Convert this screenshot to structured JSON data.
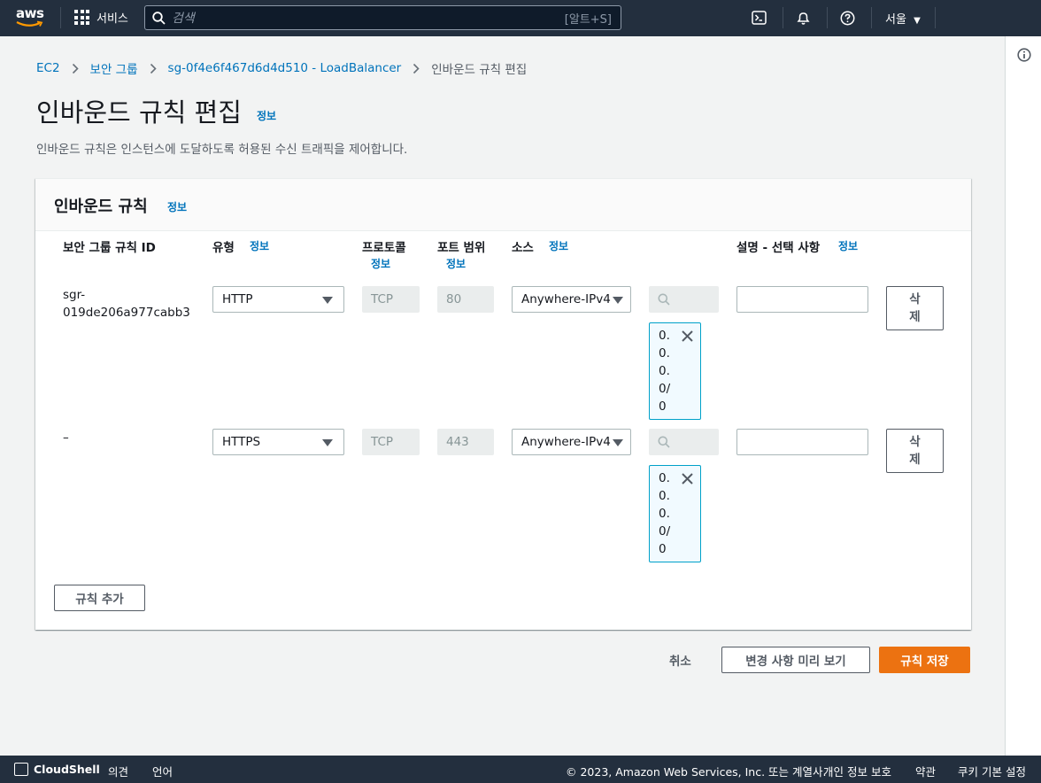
{
  "topnav": {
    "logo_text": "aws",
    "services_label": "서비스",
    "search_placeholder": "검색",
    "search_shortcut": "[알트+S]",
    "region": "서울"
  },
  "breadcrumb": {
    "items": [
      "EC2",
      "보안 그룹",
      "sg-0f4e6f467d6d4d510 - LoadBalancer",
      "인바운드 규칙 편집"
    ]
  },
  "page": {
    "title": "인바운드 규칙 편집",
    "info": "정보",
    "description": "인바운드 규칙은 인스턴스에 도달하도록 허용된 수신 트래픽을 제어합니다."
  },
  "panel": {
    "title": "인바운드 규칙",
    "info": "정보",
    "columns": {
      "rule_id": "보안 그룹 규칙 ID",
      "type": "유형",
      "protocol": "프로토콜",
      "port_range": "포트 범위",
      "source": "소스",
      "description": "설명 - 선택 사항",
      "info": "정보"
    },
    "rows": [
      {
        "rule_id_1": "sgr-",
        "rule_id_2": "019de206a977cabb3",
        "type": "HTTP",
        "protocol": "TCP",
        "port": "80",
        "source": "Anywhere-IPv4",
        "token": "0.0.0.0/0",
        "delete": "삭제"
      },
      {
        "rule_id_1": "–",
        "rule_id_2": "",
        "type": "HTTPS",
        "protocol": "TCP",
        "port": "443",
        "source": "Anywhere-IPv4",
        "token": "0.0.0.0/0",
        "delete": "삭제"
      }
    ],
    "add_rule": "규칙 추가"
  },
  "actions": {
    "cancel": "취소",
    "preview": "변경 사항 미리 보기",
    "save": "규칙 저장"
  },
  "footer": {
    "cloudshell": "CloudShell",
    "feedback": "의견",
    "language": "언어",
    "copyright": "© 2023, Amazon Web Services, Inc. 또는 계열사.",
    "privacy": "개인 정보 보호",
    "terms": "약관",
    "cookies": "쿠키 기본 설정"
  },
  "colors": {
    "nav_bg": "#232f3e",
    "link": "#0073bb",
    "primary": "#ec7211",
    "token_border": "#00a1c9"
  }
}
